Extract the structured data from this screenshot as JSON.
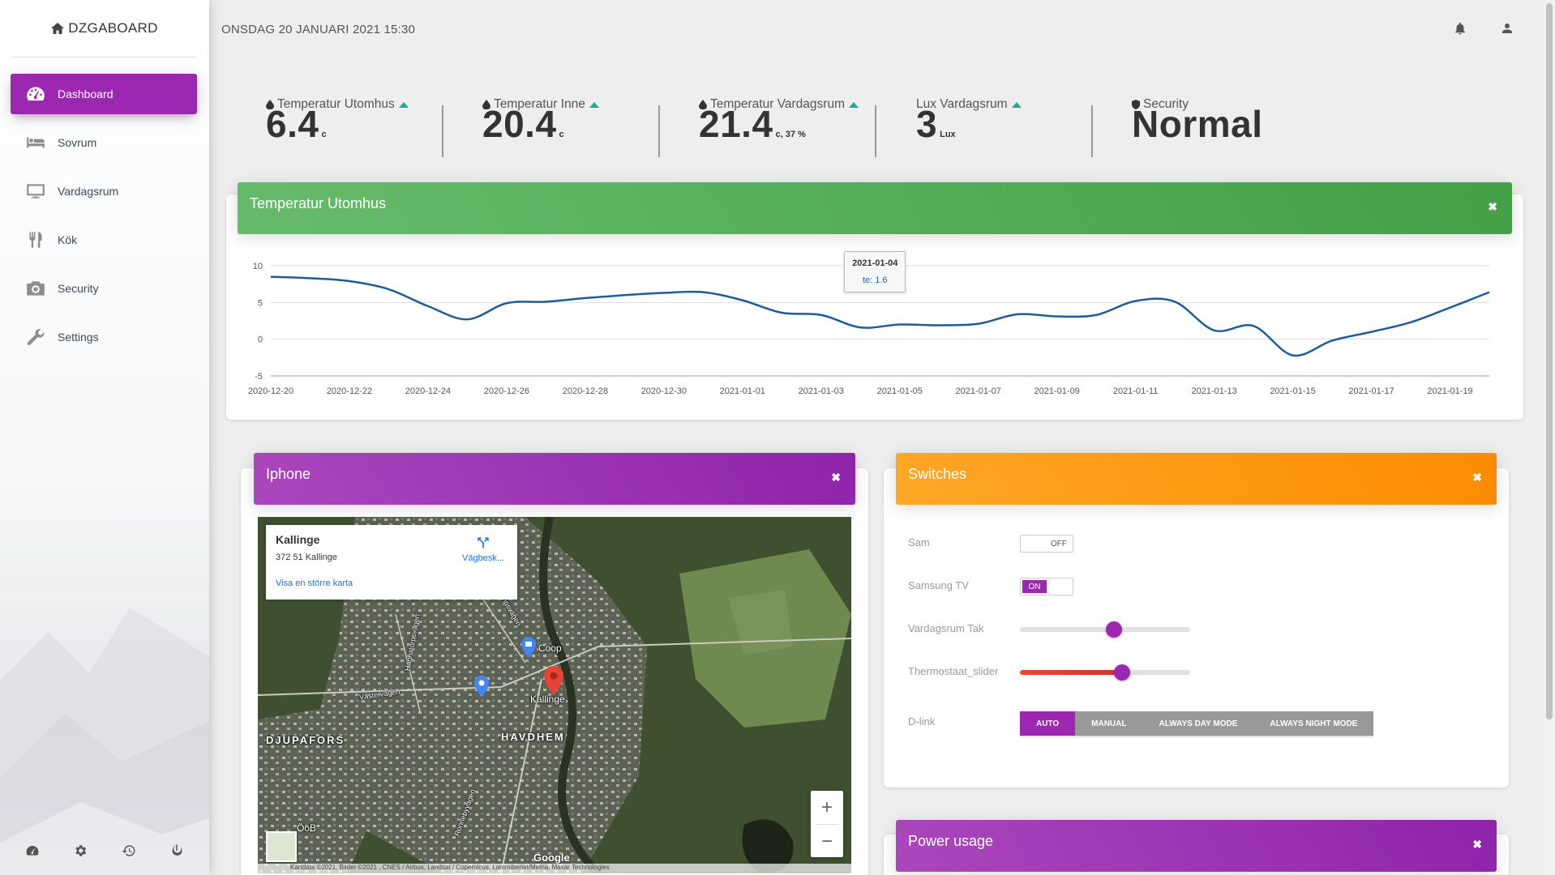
{
  "brand": "DZGABOARD",
  "nav": [
    {
      "label": "Dashboard",
      "icon": "dashboard-icon"
    },
    {
      "label": "Sovrum",
      "icon": "bed-icon"
    },
    {
      "label": "Vardagsrum",
      "icon": "monitor-icon"
    },
    {
      "label": "Kök",
      "icon": "cutlery-icon"
    },
    {
      "label": "Security",
      "icon": "camera-icon"
    },
    {
      "label": "Settings",
      "icon": "wrench-icon"
    }
  ],
  "footer_icons": [
    "dashboard-icon",
    "gear-icon",
    "history-icon",
    "power-icon"
  ],
  "datetime": "ONSDAG 20 JANUARI 2021 15:30",
  "top_icons": [
    "bell-icon",
    "user-icon"
  ],
  "stats": [
    {
      "label": "Temperatur Utomhus",
      "value": "6.4",
      "unit": "c",
      "trend": "up"
    },
    {
      "label": "Temperatur Inne",
      "value": "20.4",
      "unit": "c",
      "trend": "up"
    },
    {
      "label": "Temperatur Vardagsrum",
      "value": "21.4",
      "unit": "c, 37 %",
      "trend": "up"
    },
    {
      "label": "Lux Vardagsrum",
      "value": "3",
      "unit": "Lux",
      "trend": "up"
    },
    {
      "label": "Security",
      "value": "Normal",
      "unit": ""
    }
  ],
  "chart_card": {
    "title": "Temperatur Utomhus",
    "close": "✖"
  },
  "chart_data": {
    "type": "line",
    "x": [
      "2020-12-20",
      "2020-12-21",
      "2020-12-22",
      "2020-12-23",
      "2020-12-24",
      "2020-12-25",
      "2020-12-26",
      "2020-12-27",
      "2020-12-28",
      "2020-12-29",
      "2020-12-30",
      "2020-12-31",
      "2021-01-01",
      "2021-01-02",
      "2021-01-03",
      "2021-01-04",
      "2021-01-05",
      "2021-01-06",
      "2021-01-07",
      "2021-01-08",
      "2021-01-09",
      "2021-01-10",
      "2021-01-11",
      "2021-01-12",
      "2021-01-13",
      "2021-01-14",
      "2021-01-15",
      "2021-01-16",
      "2021-01-17",
      "2021-01-18",
      "2021-01-19",
      "2021-01-20"
    ],
    "series": [
      {
        "name": "te",
        "color": "#1f5c99",
        "values": [
          8.5,
          8.3,
          7.9,
          6.8,
          4.5,
          2.7,
          4.9,
          5.1,
          5.6,
          6.0,
          6.3,
          6.4,
          5.3,
          3.6,
          3.3,
          1.6,
          2.0,
          1.9,
          2.1,
          3.4,
          3.1,
          3.3,
          5.2,
          5.1,
          1.2,
          1.8,
          -2.2,
          -0.2,
          1.0,
          2.3,
          4.3,
          6.4
        ]
      }
    ],
    "xticks": [
      "2020-12-20",
      "2020-12-22",
      "2020-12-24",
      "2020-12-26",
      "2020-12-28",
      "2020-12-30",
      "2021-01-01",
      "2021-01-03",
      "2021-01-05",
      "2021-01-07",
      "2021-01-09",
      "2021-01-11",
      "2021-01-13",
      "2021-01-15",
      "2021-01-17",
      "2021-01-19"
    ],
    "yticks": [
      10,
      5,
      0,
      -5
    ],
    "ylim": [
      -5,
      10
    ],
    "grid": true,
    "tooltip": {
      "date": "2021-01-04",
      "series": "te",
      "value": "te: 1.6"
    }
  },
  "iphone_card": {
    "title": "Iphone",
    "close": "✖",
    "map": {
      "place": "Kallinge",
      "address": "372 51 Kallinge",
      "link": "Visa en större karta",
      "directions": "Vägbesk...",
      "labels": [
        "Coop",
        "Kallinge",
        "HAVDHEM",
        "DJUPAFORS",
        "Västervägen",
        "Hägnatorpsvägen",
        "Brunnsvägen",
        "Ronnebyvägen",
        "ÖoB",
        "Kartdata ©2021, Bilder ©2021 , CNES / Airbus, Landsat / Copernicus, Lantmäteriet/Metria, Maxar Technologies",
        "Google"
      ],
      "zoom_in": "+",
      "zoom_out": "−"
    }
  },
  "switches_card": {
    "title": "Switches",
    "close": "✖",
    "items": [
      {
        "label": "Sam",
        "type": "toggle",
        "state": "OFF"
      },
      {
        "label": "Samsung TV",
        "type": "toggle",
        "state": "ON"
      },
      {
        "label": "Vardagsrum Tak",
        "type": "slider",
        "value": 55
      },
      {
        "label": "Thermostaat_slider",
        "type": "slider",
        "value": 60
      },
      {
        "label": "D-link",
        "type": "buttons",
        "options": [
          "AUTO",
          "MANUAL",
          "ALWAYS DAY MODE",
          "ALWAYS NIGHT MODE"
        ],
        "selected": "AUTO"
      }
    ]
  },
  "power_card": {
    "title": "Power usage",
    "close": "✖"
  },
  "colors": {
    "purple": "#9c27b0",
    "green": "#4caf50",
    "orange": "#ff9800",
    "trend": "#26a69a",
    "line": "#1f5c99"
  }
}
